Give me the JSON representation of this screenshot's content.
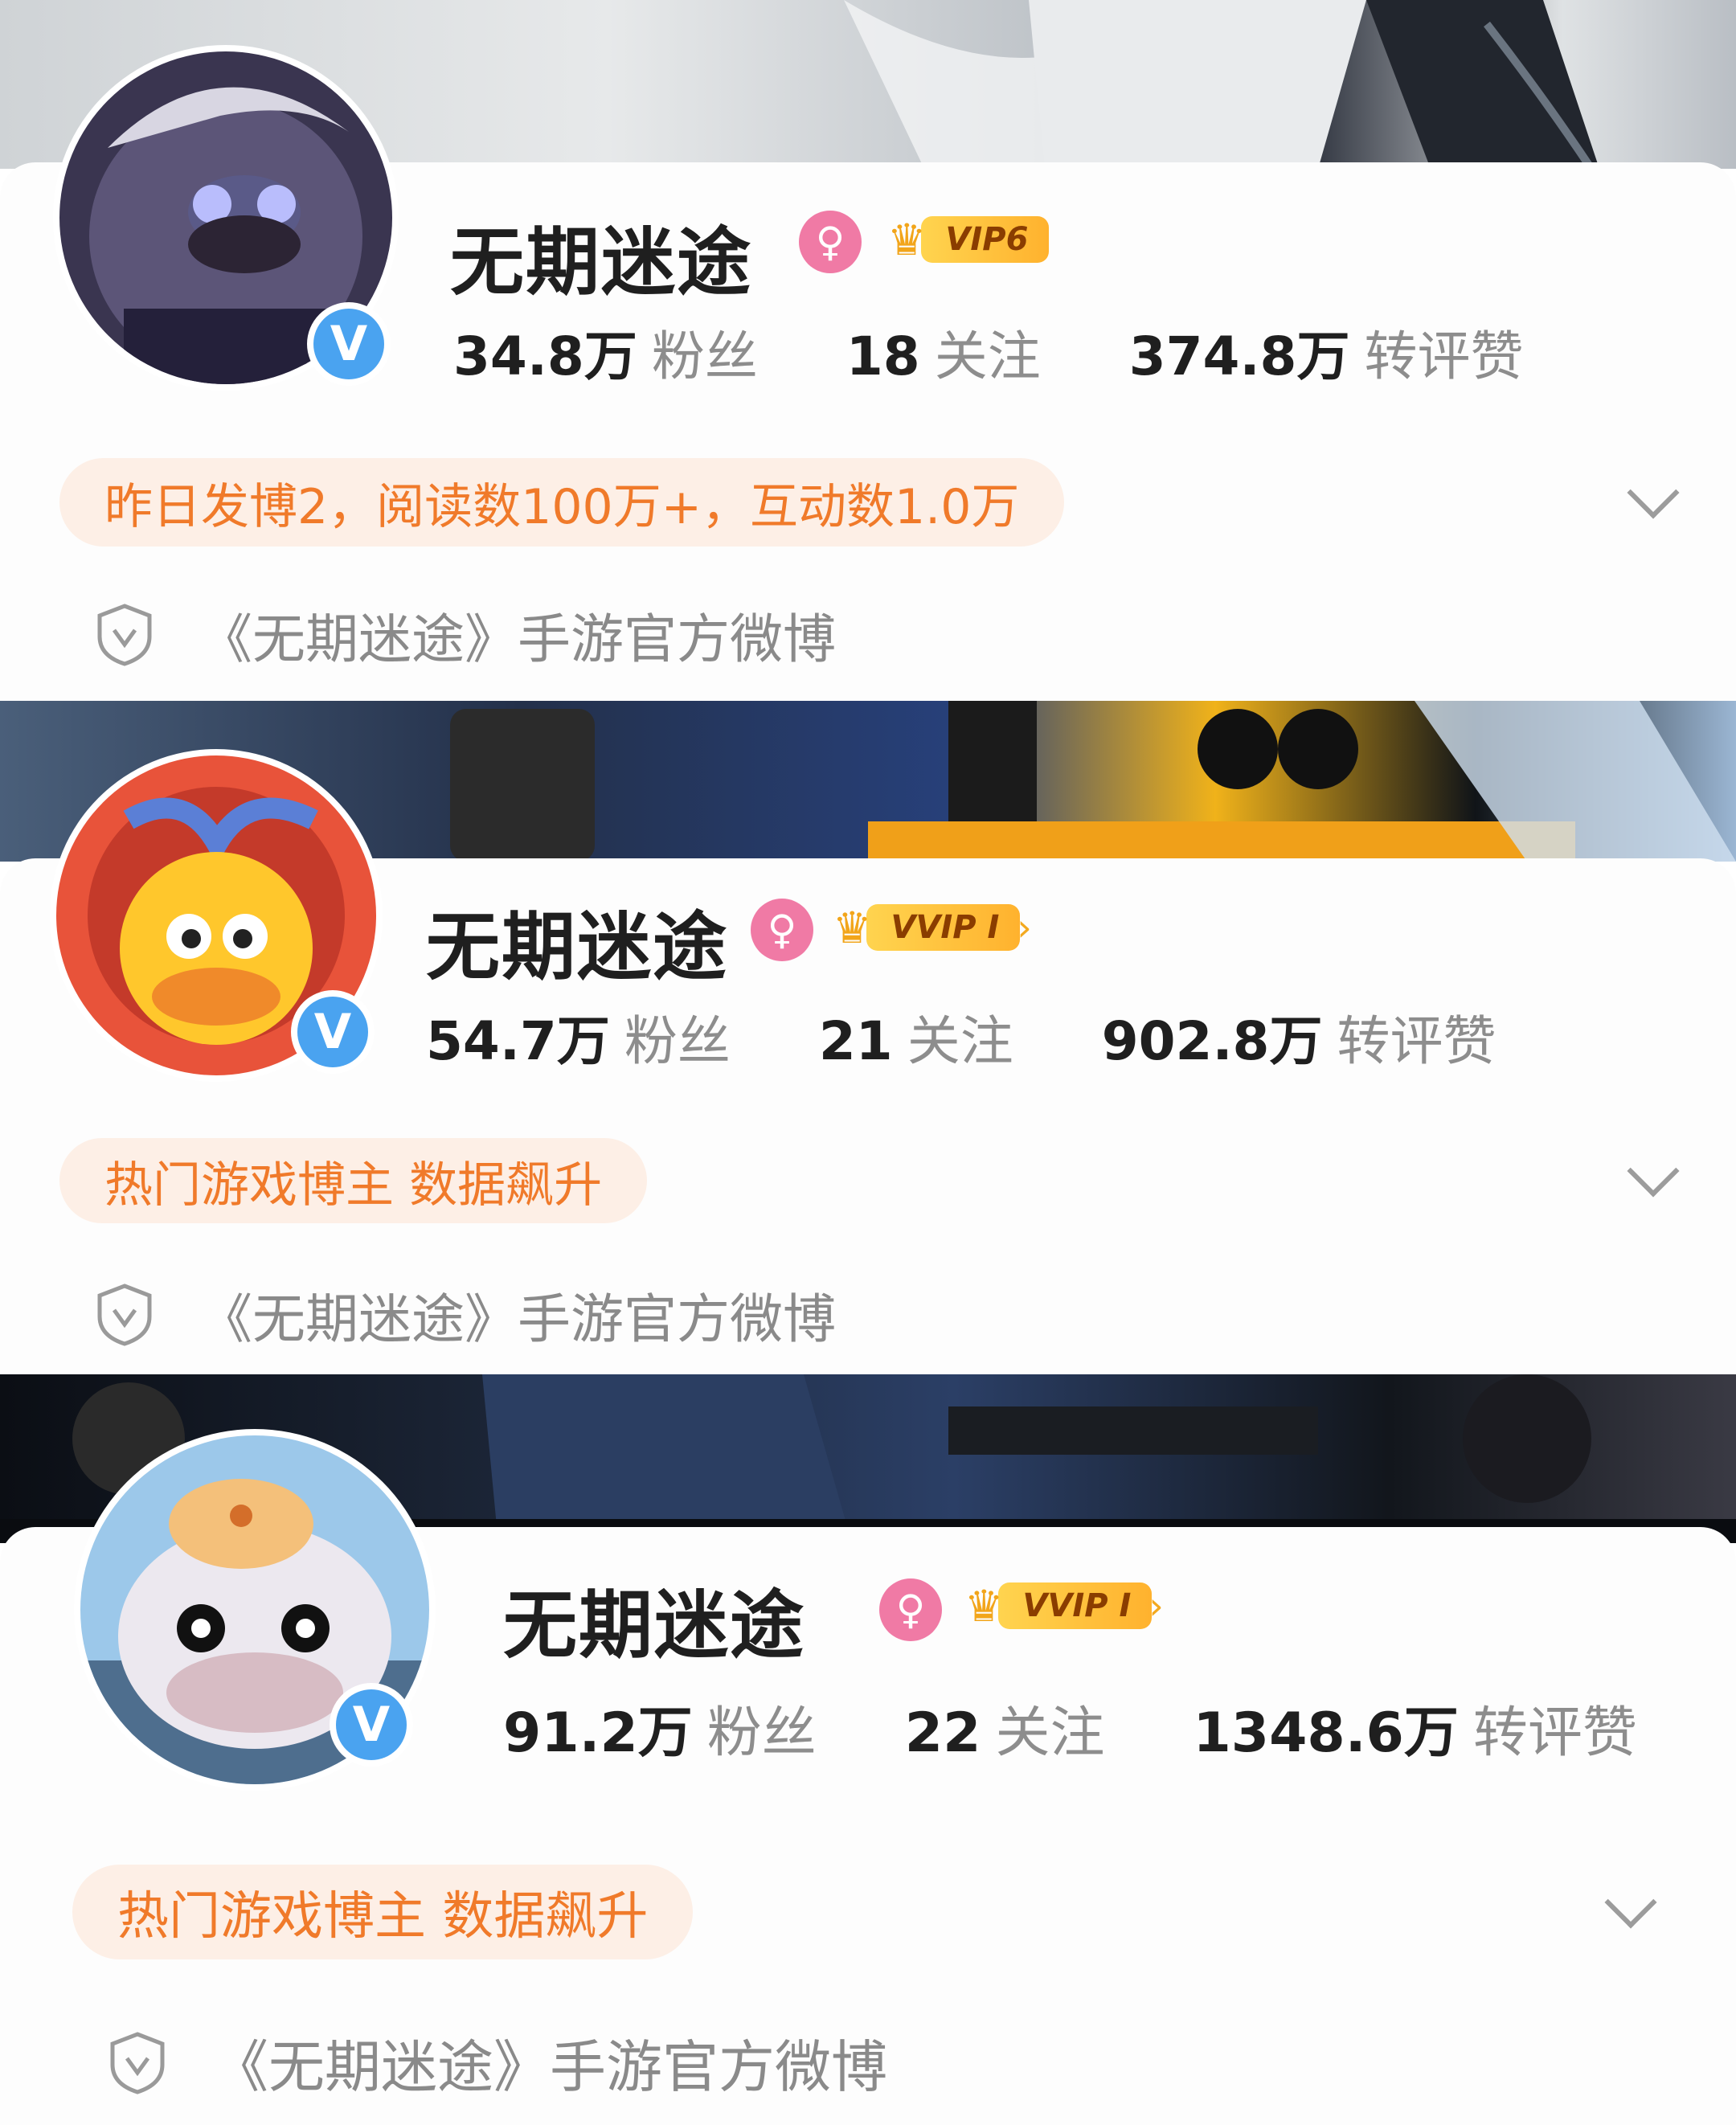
{
  "profiles": [
    {
      "name": "无期迷途",
      "gender_icon": "female-icon",
      "vip_label": "VIP6",
      "followers": "34.8万",
      "followers_label": "粉丝",
      "following": "18",
      "following_label": "关注",
      "interactions": "374.8万",
      "interactions_label": "转评赞",
      "highlight": "昨日发博2，阅读数100万+，互动数1.0万",
      "verification": "《无期迷途》手游官方微博",
      "verified_badge": "V"
    },
    {
      "name": "无期迷途",
      "gender_icon": "female-icon",
      "vip_label": "VVIP I",
      "followers": "54.7万",
      "followers_label": "粉丝",
      "following": "21",
      "following_label": "关注",
      "interactions": "902.8万",
      "interactions_label": "转评赞",
      "highlight": "热门游戏博主 数据飙升",
      "verification": "《无期迷途》手游官方微博",
      "verified_badge": "V"
    },
    {
      "name": "无期迷途",
      "gender_icon": "female-icon",
      "vip_label": "VVIP I",
      "followers": "91.2万",
      "followers_label": "粉丝",
      "following": "22",
      "following_label": "关注",
      "interactions": "1348.6万",
      "interactions_label": "转评赞",
      "highlight": "热门游戏博主 数据飙升",
      "verification": "《无期迷途》手游官方微博",
      "verified_badge": "V"
    }
  ],
  "colors": {
    "accent_orange": "#f07a2a",
    "highlight_bg": "#fdefe6",
    "verified_blue": "#4aa3f0",
    "gender_pink": "#f07aa5",
    "vip_gold": "#ffc23a"
  }
}
